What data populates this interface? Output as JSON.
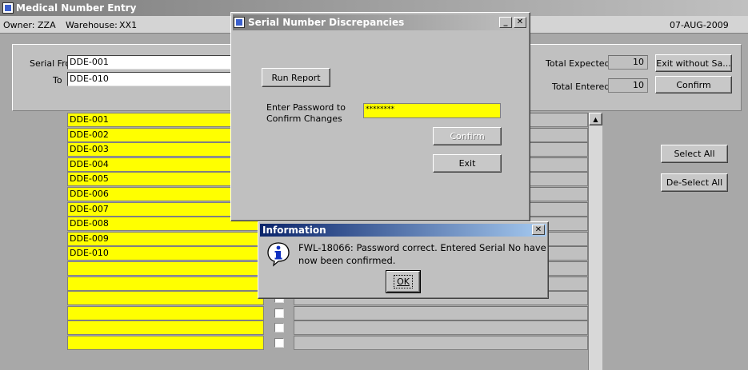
{
  "main_window": {
    "title": "Medical Number Entry",
    "owner_label": "Owner:",
    "owner_value": "ZZA",
    "warehouse_label": "Warehouse:",
    "warehouse_value": "XX1",
    "date": "07-AUG-2009"
  },
  "criteria": {
    "serial_from_label": "Serial From",
    "serial_from_value": "DDE-001",
    "to_label": "To",
    "to_value": "DDE-010",
    "total_expected_label": "Total Expected",
    "total_expected_value": "10",
    "total_entered_label": "Total Entered",
    "total_entered_value": "10",
    "exit_without_save_label": "Exit without Sa...",
    "confirm_label": "Confirm"
  },
  "serial_rows": [
    "DDE-001",
    "DDE-002",
    "DDE-003",
    "DDE-004",
    "DDE-005",
    "DDE-006",
    "DDE-007",
    "DDE-008",
    "DDE-009",
    "DDE-010",
    "",
    "",
    "",
    "",
    "",
    ""
  ],
  "side_buttons": {
    "select_all_label": "Select All",
    "deselect_all_label": "De-Select All"
  },
  "discrepancy_dialog": {
    "title": "Serial Number Discrepancies",
    "run_report_label": "Run Report",
    "password_prompt_line1": "Enter Password to",
    "password_prompt_line2": "Confirm Changes",
    "password_value": "********",
    "confirm_label": "Confirm",
    "exit_label": "Exit",
    "minimize_glyph": "_",
    "close_glyph": "✕"
  },
  "info_dialog": {
    "title": "Information",
    "icon": "info-icon",
    "message_line1": "FWL-18066:  Password correct. Entered Serial No have",
    "message_line2": "now been confirmed.",
    "ok_label": "OK",
    "close_glyph": "✕"
  },
  "colors": {
    "highlight_field": "#ffff00",
    "title_active": "#0a246a",
    "title_inactive": "#7e7e7e"
  }
}
